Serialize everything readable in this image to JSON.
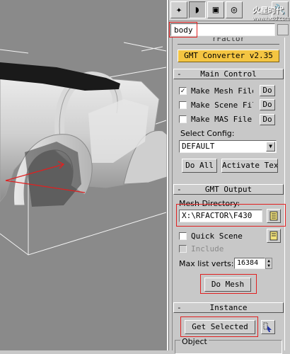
{
  "toolbar": {
    "tabs": [
      {
        "icon": "create-icon",
        "glyph": "✦"
      },
      {
        "icon": "modify-icon",
        "glyph": "◗"
      },
      {
        "icon": "hierarchy-icon",
        "glyph": "▣"
      },
      {
        "icon": "motion-icon",
        "glyph": "◎"
      },
      {
        "icon": "utilities-icon",
        "glyph": "🔧"
      }
    ],
    "watermark": "火星时代",
    "watermark_sub": "www.hxsd.com"
  },
  "object_name": "body",
  "rollouts": {
    "factor_partial": "rFactor",
    "gmt_converter_label": "GMT Converter v2.35",
    "main_control": {
      "title": "Main Control",
      "collapse": "-",
      "make_mesh_file": "Make Mesh File",
      "make_scene_file": "Make Scene File",
      "make_mas_file": "Make MAS File",
      "do_label": "Do",
      "select_config_label": "Select Config:",
      "config_value": "DEFAULT",
      "do_all": "Do All",
      "activate_tex": "Activate Tex"
    },
    "gmt_output": {
      "title": "GMT Output",
      "collapse": "-",
      "mesh_directory_label": "Mesh Directory:",
      "mesh_directory_value": "X:\\RFACTOR\\F430",
      "quick_scene": "Quick Scene",
      "include": "Include",
      "max_list_verts_label": "Max list verts:",
      "max_list_verts_value": "16384",
      "do_mesh": "Do Mesh"
    },
    "instance": {
      "title": "Instance",
      "collapse": "-",
      "get_selected": "Get Selected",
      "object_group": "Object"
    }
  },
  "checkbox_state": {
    "make_mesh_file": true,
    "make_scene_file": false,
    "make_mas_file": false,
    "quick_scene": false,
    "include": false
  },
  "colors": {
    "highlight": "#e02020",
    "gmt_button": "#f4c542",
    "viewport": "#8a8a8a",
    "panel": "#c8c8c8"
  }
}
